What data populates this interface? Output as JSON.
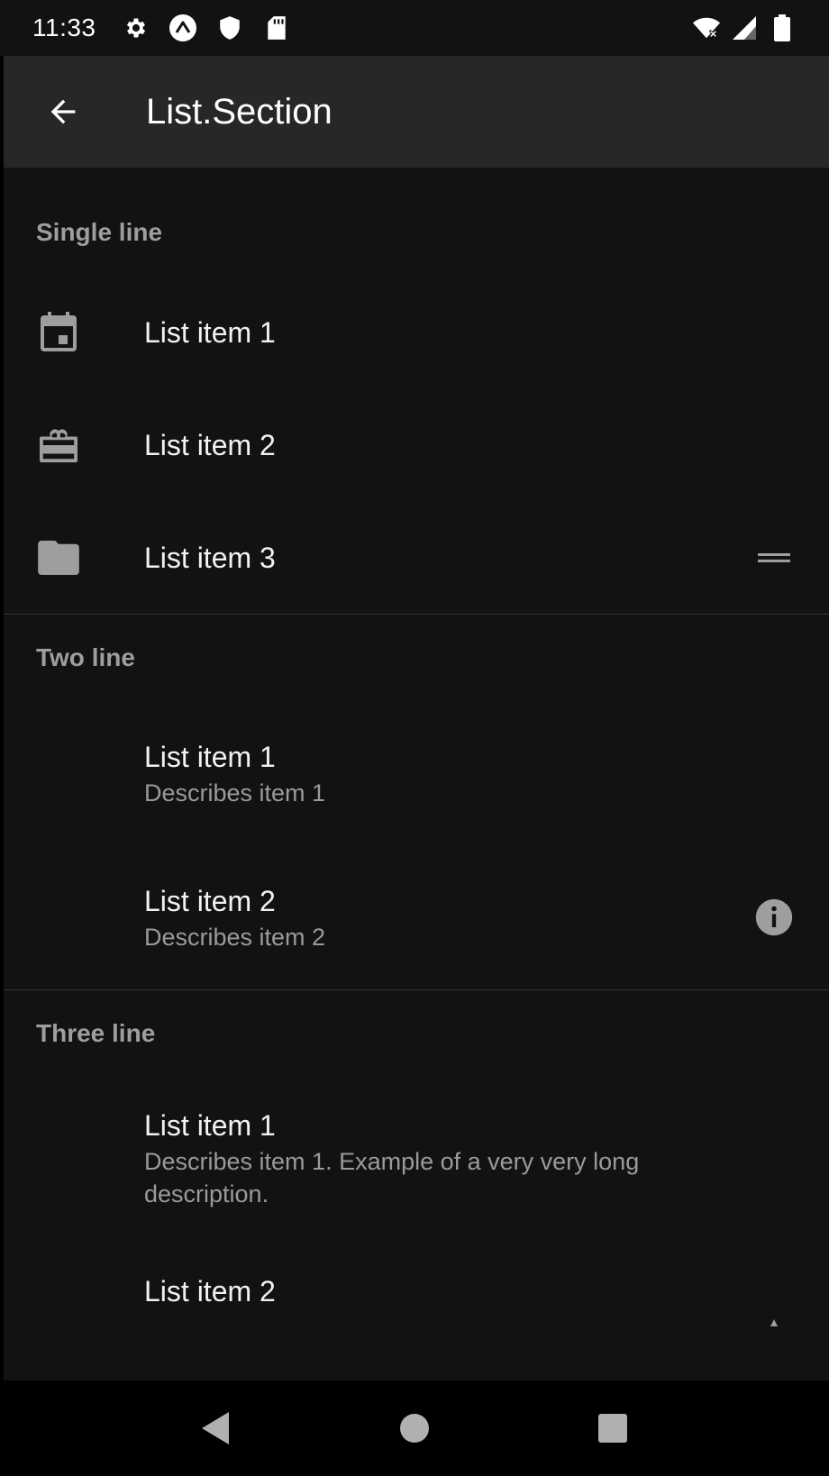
{
  "status_bar": {
    "time": "11:33",
    "left_icons": [
      "gear-icon",
      "expo-icon",
      "shield-icon",
      "sd-card-icon"
    ],
    "right_icons": [
      "wifi-icon",
      "signal-icon",
      "battery-icon"
    ]
  },
  "app_bar": {
    "title": "List.Section",
    "back_icon": "arrow-left-icon"
  },
  "sections": [
    {
      "header": "Single line",
      "items": [
        {
          "title": "List item 1",
          "left_icon": "calendar-icon"
        },
        {
          "title": "List item 2",
          "left_icon": "wallet-giftcard-icon"
        },
        {
          "title": "List item 3",
          "left_icon": "folder-icon",
          "right_icon": "drag-handle-icon"
        }
      ]
    },
    {
      "header": "Two line",
      "items": [
        {
          "title": "List item 1",
          "description": "Describes item 1"
        },
        {
          "title": "List item 2",
          "description": "Describes item 2",
          "right_icon": "info-icon"
        }
      ]
    },
    {
      "header": "Three line",
      "items": [
        {
          "title": "List item 1",
          "description": "Describes item 1. Example of a very very long description."
        },
        {
          "title": "List item 2"
        }
      ]
    }
  ],
  "colors": {
    "background": "#121212",
    "app_bar": "#272727",
    "section_header": "#9e9e9e",
    "title_text": "#f2f2f2",
    "secondary_text": "#9a9a9a",
    "icon": "#9e9e9e"
  },
  "nav_bar": {
    "buttons": [
      "back-triangle-icon",
      "home-circle-icon",
      "recents-square-icon"
    ]
  }
}
